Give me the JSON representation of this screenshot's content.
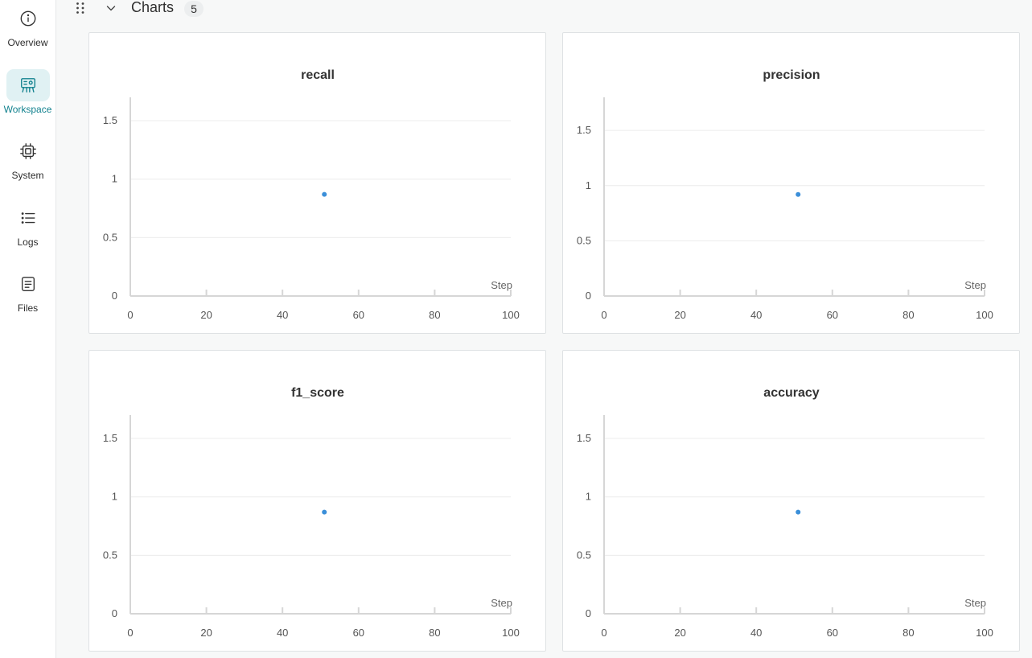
{
  "sidebar": {
    "items": [
      {
        "label": "Overview",
        "icon": "info-icon",
        "active": false
      },
      {
        "label": "Workspace",
        "icon": "workspace-icon",
        "active": true
      },
      {
        "label": "System",
        "icon": "chip-icon",
        "active": false
      },
      {
        "label": "Logs",
        "icon": "list-icon",
        "active": false
      },
      {
        "label": "Files",
        "icon": "file-icon",
        "active": false
      }
    ]
  },
  "section": {
    "title": "Charts",
    "count": "5"
  },
  "colors": {
    "accent": "#13828f",
    "point": "#3b8fd9",
    "active_bg": "#e0f1f3"
  },
  "chart_data": [
    {
      "type": "scatter",
      "title": "recall",
      "xlabel": "Step",
      "ylabel": "",
      "x": [
        51
      ],
      "y": [
        0.87
      ],
      "xlim": [
        0,
        100
      ],
      "ylim": [
        0,
        1.7
      ],
      "xticks": [
        "0",
        "20",
        "40",
        "60",
        "80",
        "100"
      ],
      "yticks": [
        "0",
        "0.5",
        "1",
        "1.5"
      ],
      "grid": true
    },
    {
      "type": "scatter",
      "title": "precision",
      "xlabel": "Step",
      "ylabel": "",
      "x": [
        51
      ],
      "y": [
        0.92
      ],
      "xlim": [
        0,
        100
      ],
      "ylim": [
        0,
        1.8
      ],
      "xticks": [
        "0",
        "20",
        "40",
        "60",
        "80",
        "100"
      ],
      "yticks": [
        "0",
        "0.5",
        "1",
        "1.5"
      ],
      "grid": true
    },
    {
      "type": "scatter",
      "title": "f1_score",
      "xlabel": "Step",
      "ylabel": "",
      "x": [
        51
      ],
      "y": [
        0.87
      ],
      "xlim": [
        0,
        100
      ],
      "ylim": [
        0,
        1.7
      ],
      "xticks": [
        "0",
        "20",
        "40",
        "60",
        "80",
        "100"
      ],
      "yticks": [
        "0",
        "0.5",
        "1",
        "1.5"
      ],
      "grid": true
    },
    {
      "type": "scatter",
      "title": "accuracy",
      "xlabel": "Step",
      "ylabel": "",
      "x": [
        51
      ],
      "y": [
        0.87
      ],
      "xlim": [
        0,
        100
      ],
      "ylim": [
        0,
        1.7
      ],
      "xticks": [
        "0",
        "20",
        "40",
        "60",
        "80",
        "100"
      ],
      "yticks": [
        "0",
        "0.5",
        "1",
        "1.5"
      ],
      "grid": true
    }
  ]
}
